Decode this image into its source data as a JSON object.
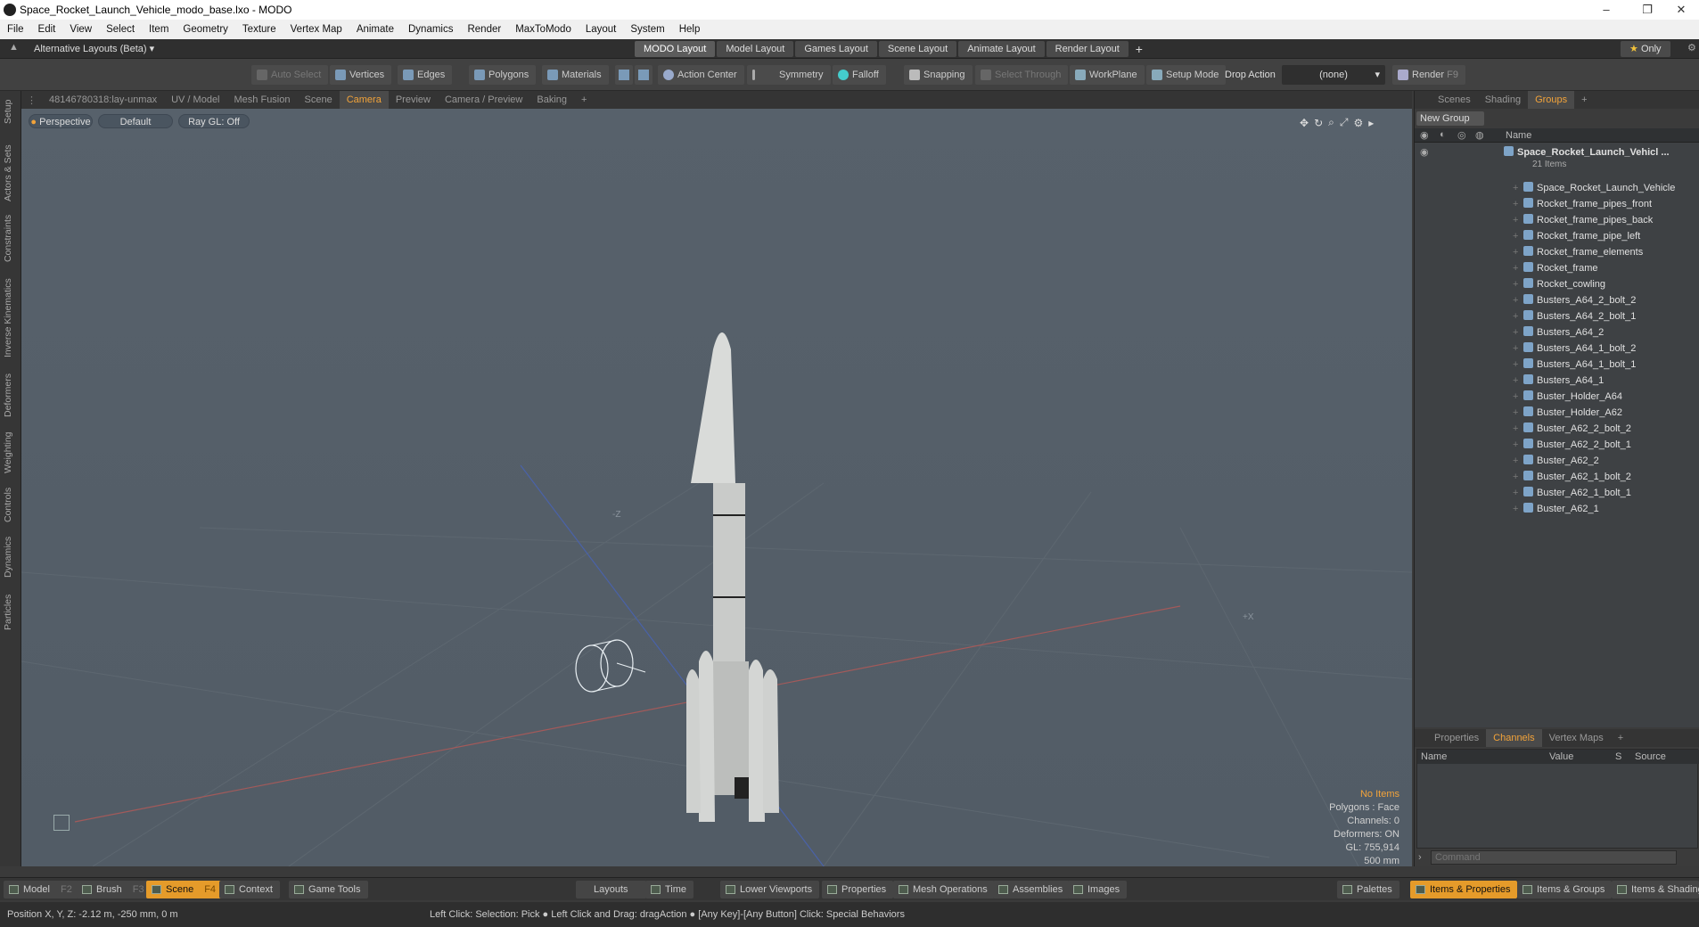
{
  "window": {
    "title": "Space_Rocket_Launch_Vehicle_modo_base.lxo - MODO"
  },
  "menu": [
    "File",
    "Edit",
    "View",
    "Select",
    "Item",
    "Geometry",
    "Texture",
    "Vertex Map",
    "Animate",
    "Dynamics",
    "Render",
    "MaxToModo",
    "Layout",
    "System",
    "Help"
  ],
  "layouts": {
    "dropdown": "Alternative Layouts (Beta)",
    "tabs": [
      "MODO Layout",
      "Model Layout",
      "Games Layout",
      "Scene Layout",
      "Animate Layout",
      "Render Layout"
    ],
    "only": "Only"
  },
  "toolbar": {
    "auto_select": "Auto Select",
    "vertices": "Vertices",
    "edges": "Edges",
    "polygons": "Polygons",
    "materials": "Materials",
    "action_center": "Action Center",
    "symmetry": "Symmetry",
    "falloff": "Falloff",
    "snapping": "Snapping",
    "select_through": "Select Through",
    "workplane": "WorkPlane",
    "setup_mode": "Setup Mode",
    "drop_action_label": "Drop Action",
    "drop_action_value": "(none)",
    "render": "Render",
    "render_key": "F9"
  },
  "left_tabs": [
    "Setup",
    "Actors & Sets",
    "Constraints",
    "Inverse Kinematics",
    "Deformers",
    "Weighting",
    "Controls",
    "Dynamics",
    "Particles"
  ],
  "viewport_tabs": [
    "48146780318:lay-unmax",
    "UV / Model",
    "Mesh Fusion",
    "Scene",
    "Camera",
    "Preview",
    "Camera / Preview",
    "Baking"
  ],
  "viewport": {
    "view": "Perspective",
    "shading": "Default",
    "raygl": "Ray GL: Off",
    "axis_z": "-Z",
    "axis_x": "+X",
    "info": {
      "items": "No Items",
      "polygons": "Polygons : Face",
      "channels": "Channels: 0",
      "deformers": "Deformers: ON",
      "gl": "GL: 755,914",
      "scale": "500 mm"
    }
  },
  "right": {
    "tabs": [
      "Scenes",
      "Shading",
      "Groups"
    ],
    "new_group": "New Group",
    "name_header": "Name",
    "group_name": "Space_Rocket_Launch_Vehicl ...",
    "group_count": "21 Items",
    "items": [
      "Space_Rocket_Launch_Vehicle",
      "Rocket_frame_pipes_front",
      "Rocket_frame_pipes_back",
      "Rocket_frame_pipe_left",
      "Rocket_frame_elements",
      "Rocket_frame",
      "Rocket_cowling",
      "Busters_A64_2_bolt_2",
      "Busters_A64_2_bolt_1",
      "Busters_A64_2",
      "Busters_A64_1_bolt_2",
      "Busters_A64_1_bolt_1",
      "Busters_A64_1",
      "Buster_Holder_A64",
      "Buster_Holder_A62",
      "Buster_A62_2_bolt_2",
      "Buster_A62_2_bolt_1",
      "Buster_A62_2",
      "Buster_A62_1_bolt_2",
      "Buster_A62_1_bolt_1",
      "Buster_A62_1"
    ],
    "lower_tabs": [
      "Properties",
      "Channels",
      "Vertex Maps"
    ],
    "channel_headers": [
      "Name",
      "Value",
      "S",
      "Source"
    ],
    "command_placeholder": "Command"
  },
  "bottom": {
    "model": "Model",
    "model_key": "F2",
    "brush": "Brush",
    "brush_key": "F3",
    "scene": "Scene",
    "scene_key": "F4",
    "context": "Context",
    "game_tools": "Game Tools",
    "layouts": "Layouts",
    "time": "Time",
    "lower_viewports": "Lower Viewports",
    "properties": "Properties",
    "mesh_operations": "Mesh Operations",
    "assemblies": "Assemblies",
    "images": "Images",
    "palettes": "Palettes",
    "items_properties": "Items & Properties",
    "items_groups": "Items & Groups",
    "items_shading": "Items & Shading"
  },
  "status": {
    "position": "Position X, Y, Z:   -2.12 m, -250 mm, 0 m",
    "hint": "Left Click: Selection: Pick ● Left Click and Drag: dragAction ● [Any Key]-[Any Button] Click: Special Behaviors"
  },
  "colors": {
    "accent": "#f2a33a",
    "active_tab": "#e59b2a",
    "viewport": "#56606a"
  }
}
